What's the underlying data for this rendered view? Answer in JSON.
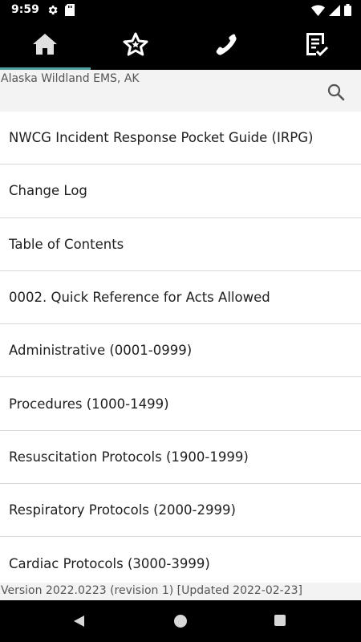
{
  "status_bar": {
    "time": "9:59",
    "icons": [
      "gear-icon",
      "sd-card-icon",
      "wifi-icon",
      "signal-icon",
      "battery-icon"
    ]
  },
  "tabs": [
    {
      "icon": "home-icon",
      "active": true
    },
    {
      "icon": "star-icon",
      "active": false
    },
    {
      "icon": "phone-icon",
      "active": false
    },
    {
      "icon": "checklist-icon",
      "active": false
    }
  ],
  "location": {
    "label": "Alaska Wildland EMS, AK"
  },
  "list": {
    "items": [
      {
        "label": "NWCG Incident Response Pocket Guide (IRPG)"
      },
      {
        "label": "Change Log"
      },
      {
        "label": "Table of Contents"
      },
      {
        "label": "0002. Quick Reference for Acts Allowed"
      },
      {
        "label": "Administrative (0001-0999)"
      },
      {
        "label": "Procedures (1000-1499)"
      },
      {
        "label": "Resuscitation Protocols (1900-1999)"
      },
      {
        "label": "Respiratory Protocols (2000-2999)"
      },
      {
        "label": "Cardiac Protocols (3000-3999)"
      }
    ]
  },
  "footer": {
    "version_text": "Version 2022.0223 (revision 1) [Updated 2022-02-23]"
  },
  "colors": {
    "accent": "#4fa0a0",
    "bar_background": "#000000",
    "header_background": "#f3f3f3"
  }
}
